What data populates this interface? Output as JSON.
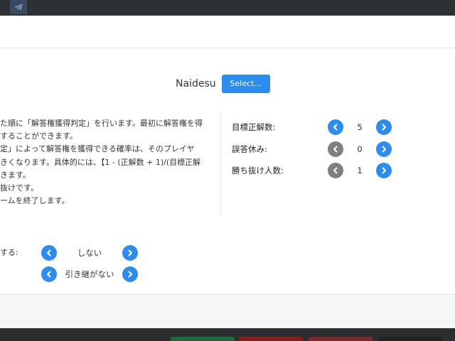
{
  "user": {
    "name": "Naidesu",
    "select_label": "Select..."
  },
  "description_lines": [
    "た順に「解答権獲得判定」を行います。最初に解答権を得",
    "することができます。",
    "定」によって解答権を獲得できる確率は、そのプレイヤ",
    "きくなります。具体的には、【1 - (正解数 + 1)/(目標正解",
    "きます。",
    "抜けです。",
    "ームを終了します。"
  ],
  "settings": [
    {
      "label": "目標正解数:",
      "value": "5",
      "decrement_enabled": true
    },
    {
      "label": "誤答休み:",
      "value": "0",
      "decrement_enabled": false
    },
    {
      "label": "勝ち抜け人数:",
      "value": "1",
      "decrement_enabled": false
    }
  ],
  "options": {
    "label": "する:",
    "values": [
      "しない",
      "引き継がない"
    ]
  },
  "colors": {
    "accent": "#2d8cf0",
    "disabled": "#7f7f7f"
  },
  "bottom_buttons": [
    {
      "color": "#1e6b3a"
    },
    {
      "color": "#8a1c1c"
    },
    {
      "color": "#7a2a2a"
    },
    {
      "color": "#222222"
    }
  ]
}
